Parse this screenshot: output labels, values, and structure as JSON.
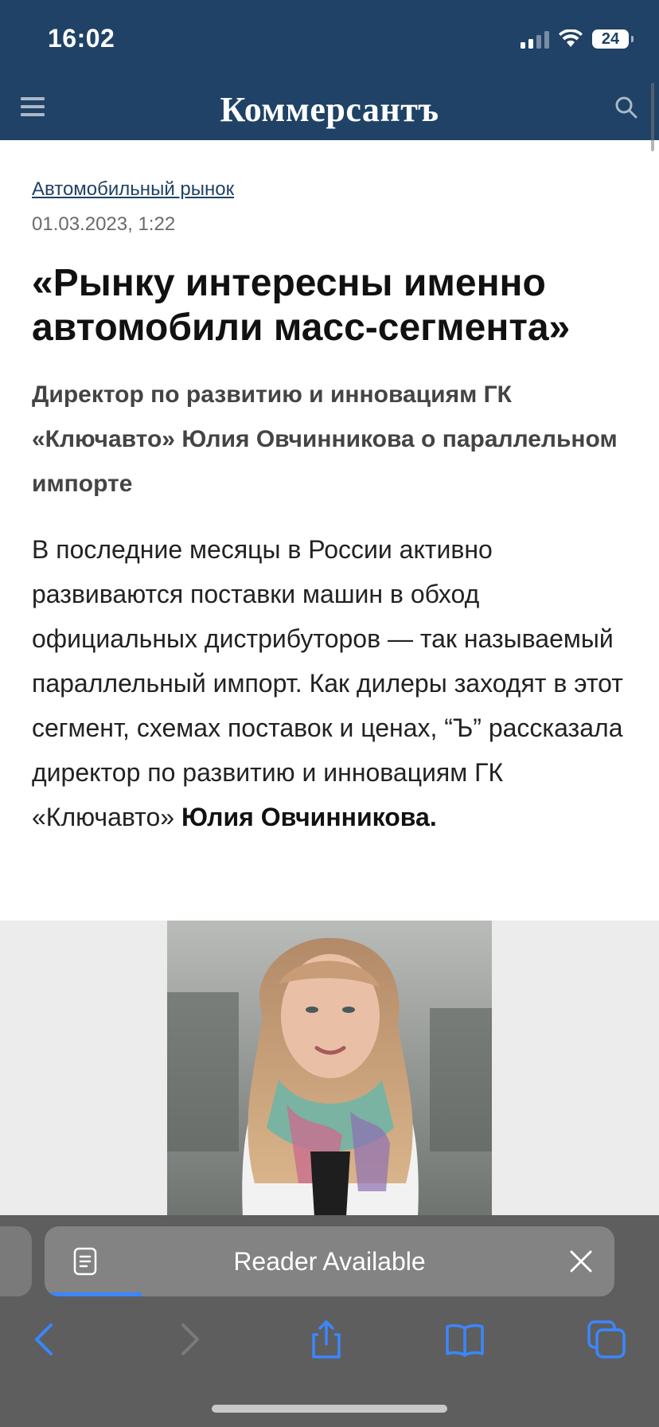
{
  "status_bar": {
    "time": "16:02",
    "battery": "24"
  },
  "header": {
    "logo": "Коммерсантъ",
    "menu_icon": "hamburger-menu-icon",
    "search_icon": "search-icon",
    "background": "#1f4266"
  },
  "article": {
    "category": "Автомобильный рынок",
    "date": "01.03.2023, 1:22",
    "headline": "«Рынку интересны именно автомобили масс-сегмента»",
    "lead": "Директор по развитию и инновациям ГК «Ключавто» Юлия Овчинникова о параллельном импорте",
    "body": "В последние месяцы в России активно развиваются поставки машин в обход официальных дистрибуторов — так называемый параллельный импорт. Как дилеры заходят в этот сегмент, схемах поставок и ценах, “Ъ” рассказала директор по развитию и инновациям ГК «Ключавто» ",
    "body_bold": "Юлия Овчинникова."
  },
  "reader_bar": {
    "label": "Reader Available",
    "load_progress": 0.17
  },
  "toolbar": {
    "accent": "#3a87ff",
    "items": [
      "back-icon",
      "forward-icon",
      "share-icon",
      "bookmarks-icon",
      "tabs-icon"
    ]
  }
}
